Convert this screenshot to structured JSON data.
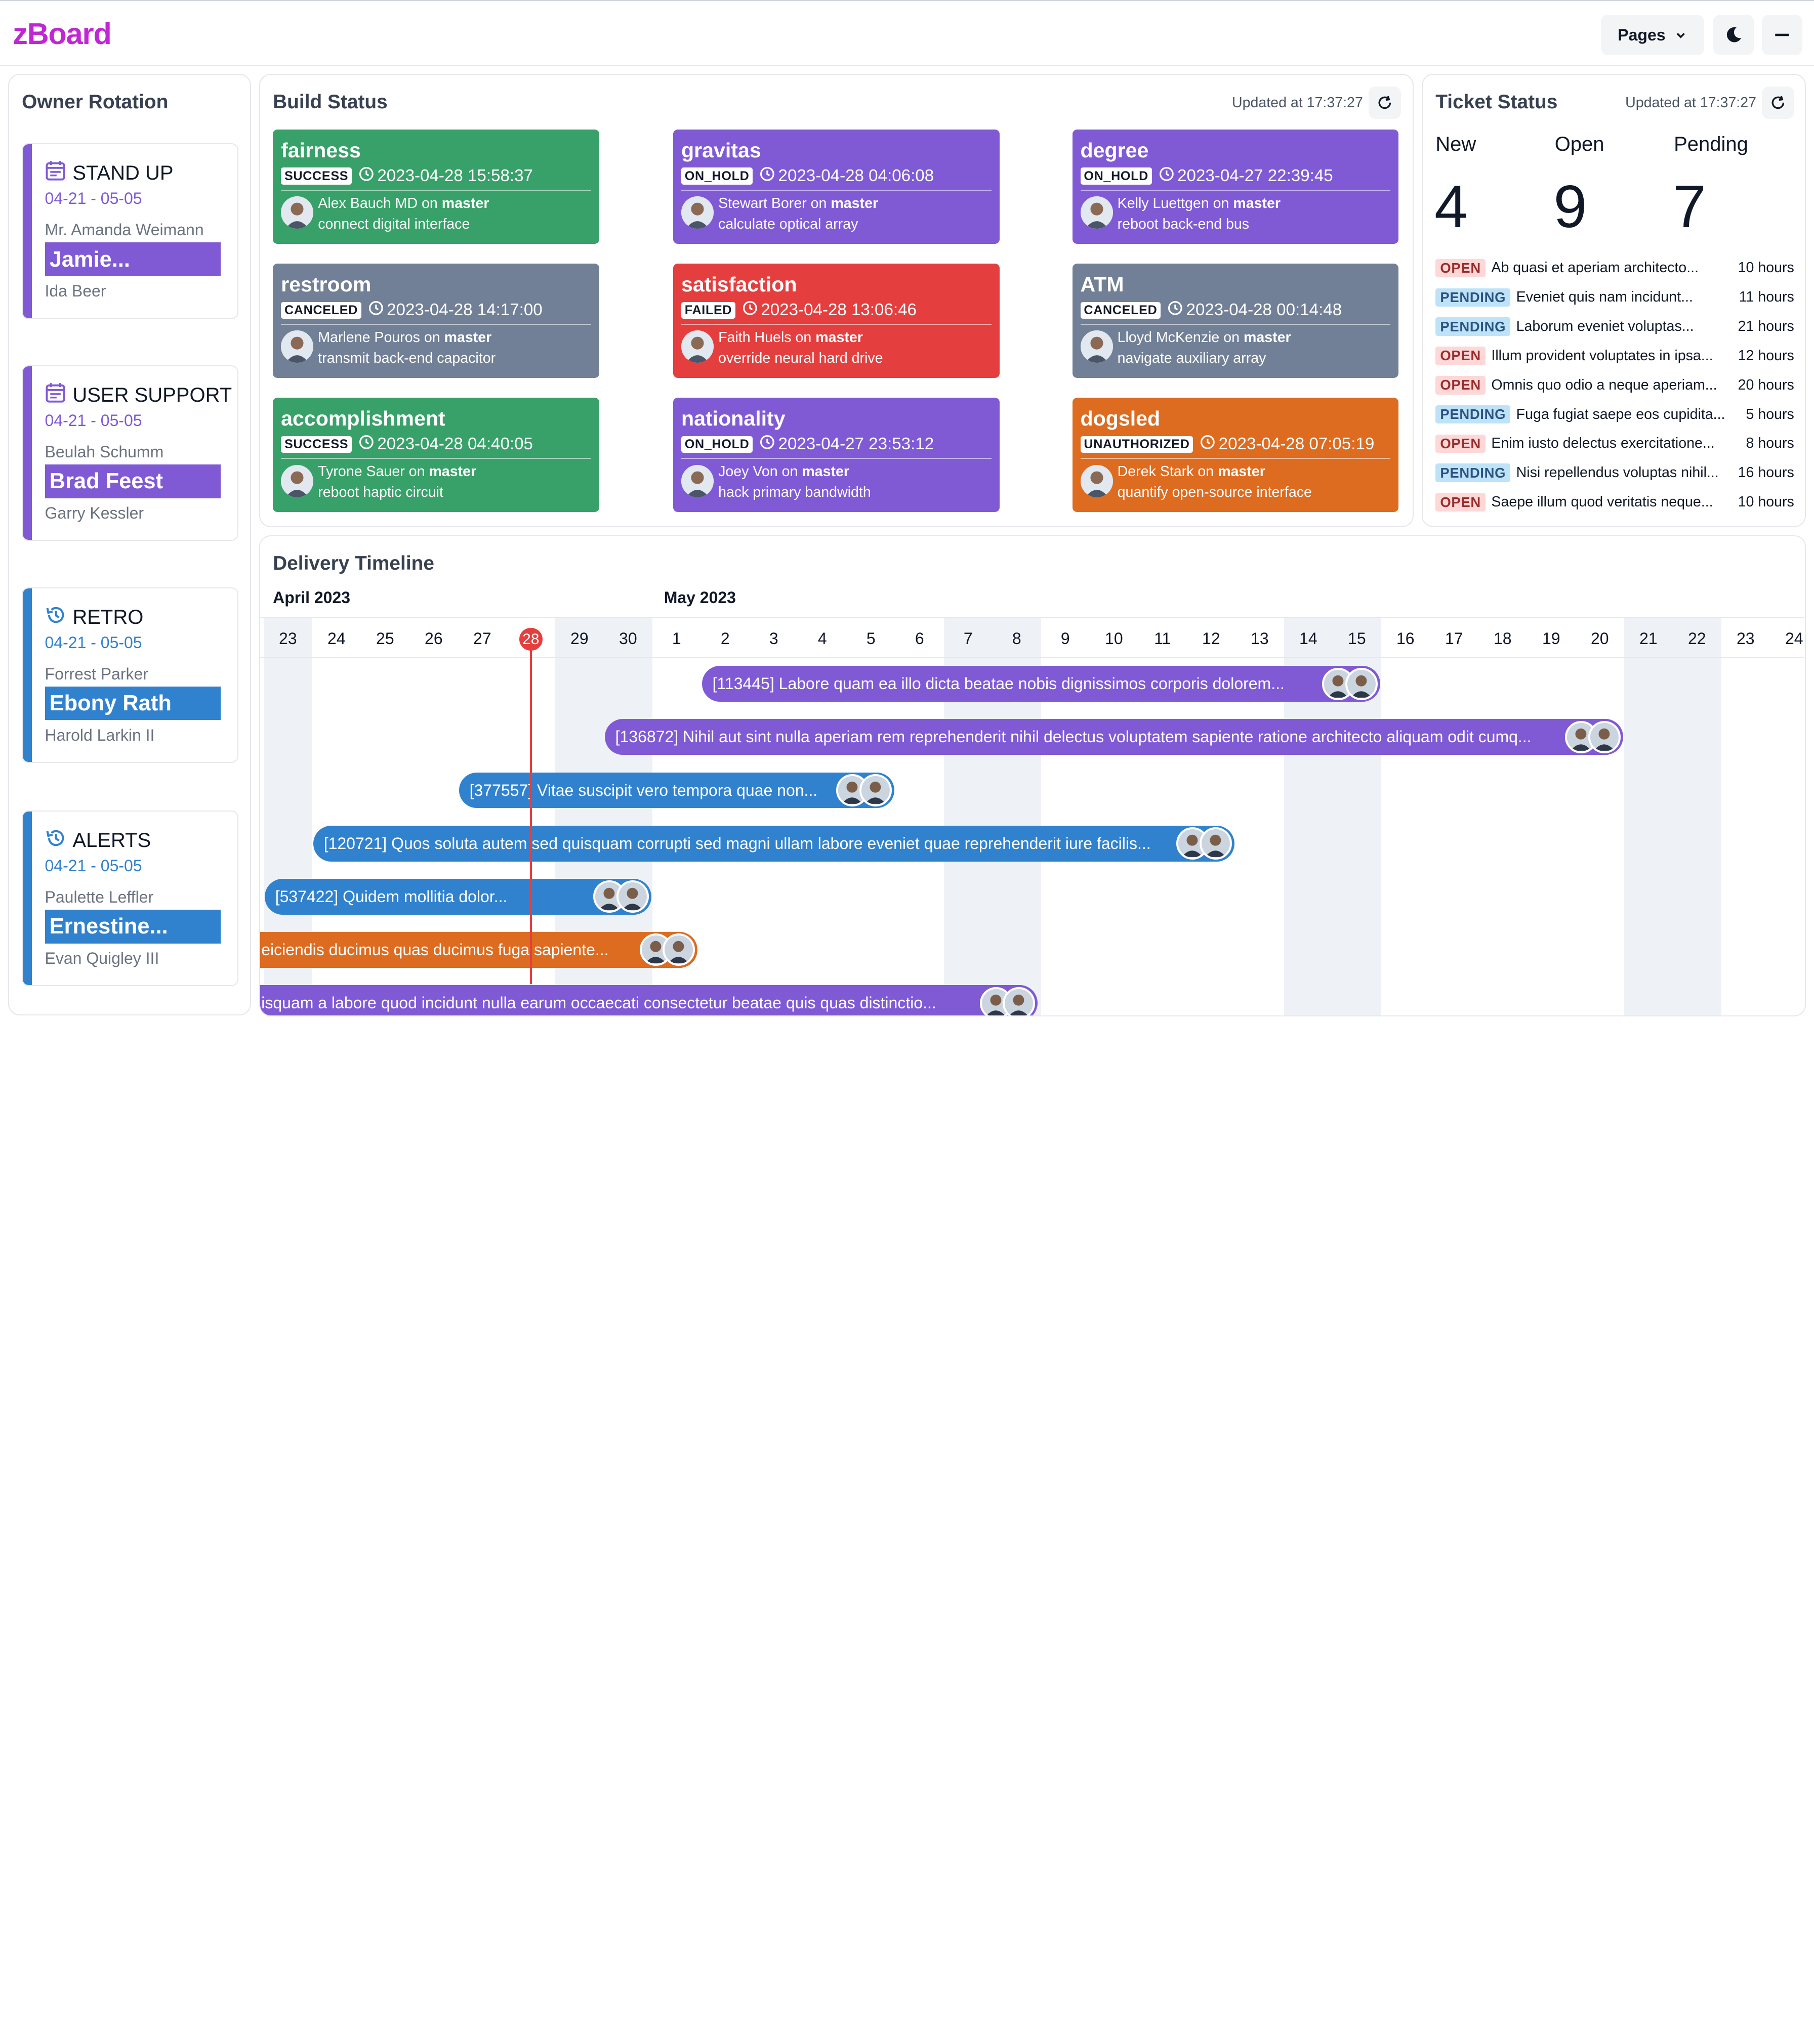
{
  "header": {
    "logo": "zBoard",
    "pages_label": "Pages"
  },
  "rotation": {
    "title": "Owner Rotation",
    "cards": [
      {
        "name": "STAND UP",
        "icon": "calendar-icon",
        "color": "#805ad5",
        "dates": "04-21 - 05-05",
        "prev": "Mr. Amanda Weimann",
        "current": "Jamie...",
        "next": "Ida Beer"
      },
      {
        "name": "USER SUPPORT",
        "icon": "calendar-icon",
        "color": "#805ad5",
        "dates": "04-21 - 05-05",
        "prev": "Beulah Schumm",
        "current": "Brad Feest",
        "next": "Garry Kessler"
      },
      {
        "name": "RETRO",
        "icon": "history-icon",
        "color": "#3182ce",
        "dates": "04-21 - 05-05",
        "prev": "Forrest Parker",
        "current": "Ebony Rath",
        "next": "Harold Larkin II"
      },
      {
        "name": "ALERTS",
        "icon": "history-icon",
        "color": "#3182ce",
        "dates": "04-21 - 05-05",
        "prev": "Paulette Leffler",
        "current": "Ernestine...",
        "next": "Evan Quigley III"
      }
    ]
  },
  "build": {
    "title": "Build Status",
    "updated": "Updated at 17:37:27",
    "cards": [
      {
        "name": "fairness",
        "status": "SUCCESS",
        "color": "#38a169",
        "time": "2023-04-28 15:58:37",
        "author": "Alex Bauch MD",
        "on": "on",
        "branch": "master",
        "message": "connect digital interface"
      },
      {
        "name": "gravitas",
        "status": "ON_HOLD",
        "color": "#805ad5",
        "time": "2023-04-28 04:06:08",
        "author": "Stewart Borer",
        "on": "on",
        "branch": "master",
        "message": "calculate optical array"
      },
      {
        "name": "degree",
        "status": "ON_HOLD",
        "color": "#805ad5",
        "time": "2023-04-27 22:39:45",
        "author": "Kelly Luettgen",
        "on": "on",
        "branch": "master",
        "message": "reboot back-end bus"
      },
      {
        "name": "restroom",
        "status": "CANCELED",
        "color": "#718096",
        "time": "2023-04-28 14:17:00",
        "author": "Marlene Pouros",
        "on": "on",
        "branch": "master",
        "message": "transmit back-end capacitor"
      },
      {
        "name": "satisfaction",
        "status": "FAILED",
        "color": "#e53e3e",
        "time": "2023-04-28 13:06:46",
        "author": "Faith Huels",
        "on": "on",
        "branch": "master",
        "message": "override neural hard drive"
      },
      {
        "name": "ATM",
        "status": "CANCELED",
        "color": "#718096",
        "time": "2023-04-28 00:14:48",
        "author": "Lloyd McKenzie",
        "on": "on",
        "branch": "master",
        "message": "navigate auxiliary array"
      },
      {
        "name": "accomplishment",
        "status": "SUCCESS",
        "color": "#38a169",
        "time": "2023-04-28 04:40:05",
        "author": "Tyrone Sauer",
        "on": "on",
        "branch": "master",
        "message": "reboot haptic circuit"
      },
      {
        "name": "nationality",
        "status": "ON_HOLD",
        "color": "#805ad5",
        "time": "2023-04-27 23:53:12",
        "author": "Joey Von",
        "on": "on",
        "branch": "master",
        "message": "hack primary bandwidth"
      },
      {
        "name": "dogsled",
        "status": "UNAUTHORIZED",
        "color": "#dd6b20",
        "time": "2023-04-28 07:05:19",
        "author": "Derek Stark",
        "on": "on",
        "branch": "master",
        "message": "quantify open-source interface"
      }
    ]
  },
  "tickets": {
    "title": "Ticket Status",
    "updated": "Updated at 17:37:27",
    "counts": [
      {
        "label": "New",
        "value": "4"
      },
      {
        "label": "Open",
        "value": "9"
      },
      {
        "label": "Pending",
        "value": "7"
      }
    ],
    "rows": [
      {
        "status": "OPEN",
        "title": "Ab quasi et aperiam architecto...",
        "age": "10 hours"
      },
      {
        "status": "PENDING",
        "title": "Eveniet quis nam incidunt...",
        "age": "11 hours"
      },
      {
        "status": "PENDING",
        "title": "Laborum eveniet voluptas...",
        "age": "21 hours"
      },
      {
        "status": "OPEN",
        "title": "Illum provident voluptates in ipsa...",
        "age": "12 hours"
      },
      {
        "status": "OPEN",
        "title": "Omnis quo odio a neque aperiam...",
        "age": "20 hours"
      },
      {
        "status": "PENDING",
        "title": "Fuga fugiat saepe eos cupidita...",
        "age": "5 hours"
      },
      {
        "status": "OPEN",
        "title": "Enim iusto delectus exercitatione...",
        "age": "8 hours"
      },
      {
        "status": "PENDING",
        "title": "Nisi repellendus voluptas nihil...",
        "age": "16 hours"
      },
      {
        "status": "OPEN",
        "title": "Saepe illum quod veritatis neque...",
        "age": "10 hours"
      }
    ],
    "colors": {
      "OPEN_bg": "#fed7d7",
      "OPEN_fg": "#9b2c2c",
      "PENDING_bg": "#bee3f8",
      "PENDING_fg": "#2c5282"
    }
  },
  "timeline": {
    "title": "Delivery Timeline",
    "months": [
      "April 2023",
      "May 2023"
    ],
    "days": [
      "23",
      "24",
      "25",
      "26",
      "27",
      "28",
      "29",
      "30",
      "1",
      "2",
      "3",
      "4",
      "5",
      "6",
      "7",
      "8",
      "9",
      "10",
      "11",
      "12",
      "13",
      "14",
      "15",
      "16",
      "17",
      "18",
      "19",
      "20",
      "21",
      "22",
      "23",
      "24"
    ],
    "today_label": "28",
    "items": [
      {
        "label": "[113445] Labore quam ea illo dicta beatae nobis dignissimos corporis dolorem...",
        "color": "#805ad5"
      },
      {
        "label": "[136872] Nihil aut sint nulla aperiam rem reprehenderit nihil delectus voluptatem sapiente ratione architecto aliquam odit cumq...",
        "color": "#805ad5"
      },
      {
        "label": "[377557] Vitae suscipit vero tempora quae non...",
        "color": "#3182ce"
      },
      {
        "label": "[120721] Quos soluta autem sed quisquam corrupti sed magni ullam labore eveniet quae reprehenderit iure facilis...",
        "color": "#3182ce"
      },
      {
        "label": "[537422] Quidem mollitia dolor...",
        "color": "#3182ce"
      },
      {
        "label": "eiciendis ducimus quas ducimus fuga sapiente...",
        "color": "#dd6b20"
      },
      {
        "label": "isquam a labore quod incidunt nulla earum occaecati consectetur beatae quis quas distinctio...",
        "color": "#805ad5"
      }
    ]
  }
}
